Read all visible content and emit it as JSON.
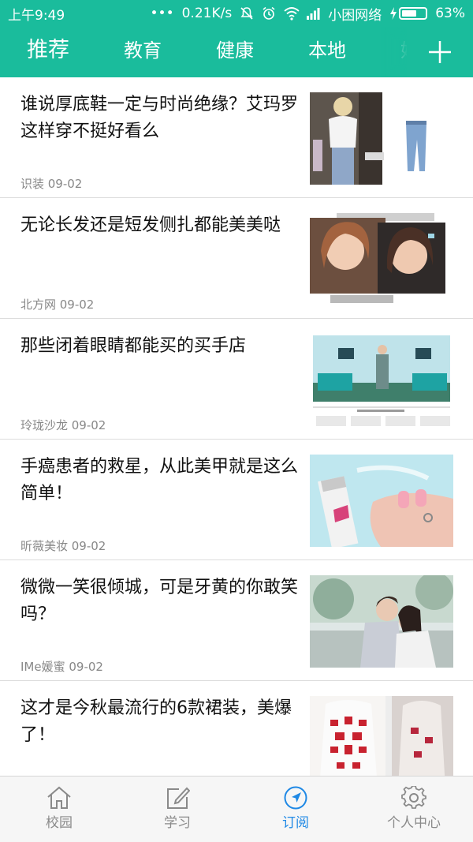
{
  "status_bar": {
    "time": "上午9:49",
    "dots": "•••",
    "speed": "0.21K/s",
    "carrier": "小困网络",
    "battery": "63%",
    "battery_level": 0.63,
    "icons": [
      "mute-icon",
      "alarm-icon",
      "wifi-icon",
      "signal-icon",
      "charging-icon",
      "battery-icon"
    ]
  },
  "tabs": [
    {
      "label": "推荐",
      "active": true
    },
    {
      "label": "教育"
    },
    {
      "label": "健康"
    },
    {
      "label": "本地"
    },
    {
      "label": "娱"
    }
  ],
  "add_channel_icon": "plus-icon",
  "articles": [
    {
      "title": "谁说厚底鞋一定与时尚绝缘？艾玛罗这样穿不挺好看么",
      "source": "识装 09-02"
    },
    {
      "title": "无论长发还是短发侧扎都能美美哒",
      "source": "北方网 09-02"
    },
    {
      "title": "那些闭着眼睛都能买的买手店",
      "source": "玲珑沙龙 09-02"
    },
    {
      "title": "手癌患者的救星，从此美甲就是这么简单！",
      "source": "昕薇美妆 09-02"
    },
    {
      "title": "微微一笑很倾城，可是牙黄的你敢笑吗？",
      "source": "IMe媛蜜 09-02"
    },
    {
      "title": "这才是今秋最流行的6款裙装，美爆了！",
      "source": ""
    }
  ],
  "bottom_nav": [
    {
      "label": "校园",
      "icon": "home-icon"
    },
    {
      "label": "学习",
      "icon": "edit-icon"
    },
    {
      "label": "订阅",
      "icon": "compass-icon",
      "active": true
    },
    {
      "label": "个人中心",
      "icon": "gear-icon"
    }
  ],
  "colors": {
    "primary": "#1abc9c",
    "active_nav": "#1e88e5",
    "text": "#111111",
    "meta": "#888888"
  }
}
